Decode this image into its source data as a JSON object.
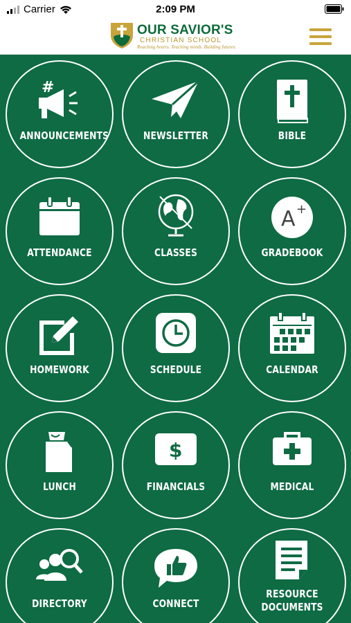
{
  "status_bar": {
    "carrier": "Carrier",
    "time": "2:09 PM"
  },
  "header": {
    "logo_title": "OUR SAVIOR'S",
    "logo_subtitle": "CHRISTIAN SCHOOL",
    "logo_tagline": "Reaching hearts. Teaching minds. Building futures.",
    "brand_green": "#0e6b44",
    "brand_gold": "#c8a43a"
  },
  "tiles": [
    {
      "label": "ANNOUNCEMENTS",
      "icon": "megaphone-icon"
    },
    {
      "label": "NEWSLETTER",
      "icon": "paper-plane-icon"
    },
    {
      "label": "BIBLE",
      "icon": "bible-icon"
    },
    {
      "label": "ATTENDANCE",
      "icon": "calendar-page-icon"
    },
    {
      "label": "CLASSES",
      "icon": "globe-icon"
    },
    {
      "label": "GRADEBOOK",
      "icon": "grade-a-plus-icon"
    },
    {
      "label": "HOMEWORK",
      "icon": "edit-icon"
    },
    {
      "label": "SCHEDULE",
      "icon": "clock-icon"
    },
    {
      "label": "CALENDAR",
      "icon": "calendar-grid-icon"
    },
    {
      "label": "LUNCH",
      "icon": "lunch-bag-icon"
    },
    {
      "label": "FINANCIALS",
      "icon": "dollar-icon"
    },
    {
      "label": "MEDICAL",
      "icon": "medical-kit-icon"
    },
    {
      "label": "DIRECTORY",
      "icon": "people-search-icon"
    },
    {
      "label": "CONNECT",
      "icon": "thumbs-up-bubble-icon"
    },
    {
      "label": "RESOURCE DOCUMENTS",
      "icon": "document-icon"
    }
  ]
}
